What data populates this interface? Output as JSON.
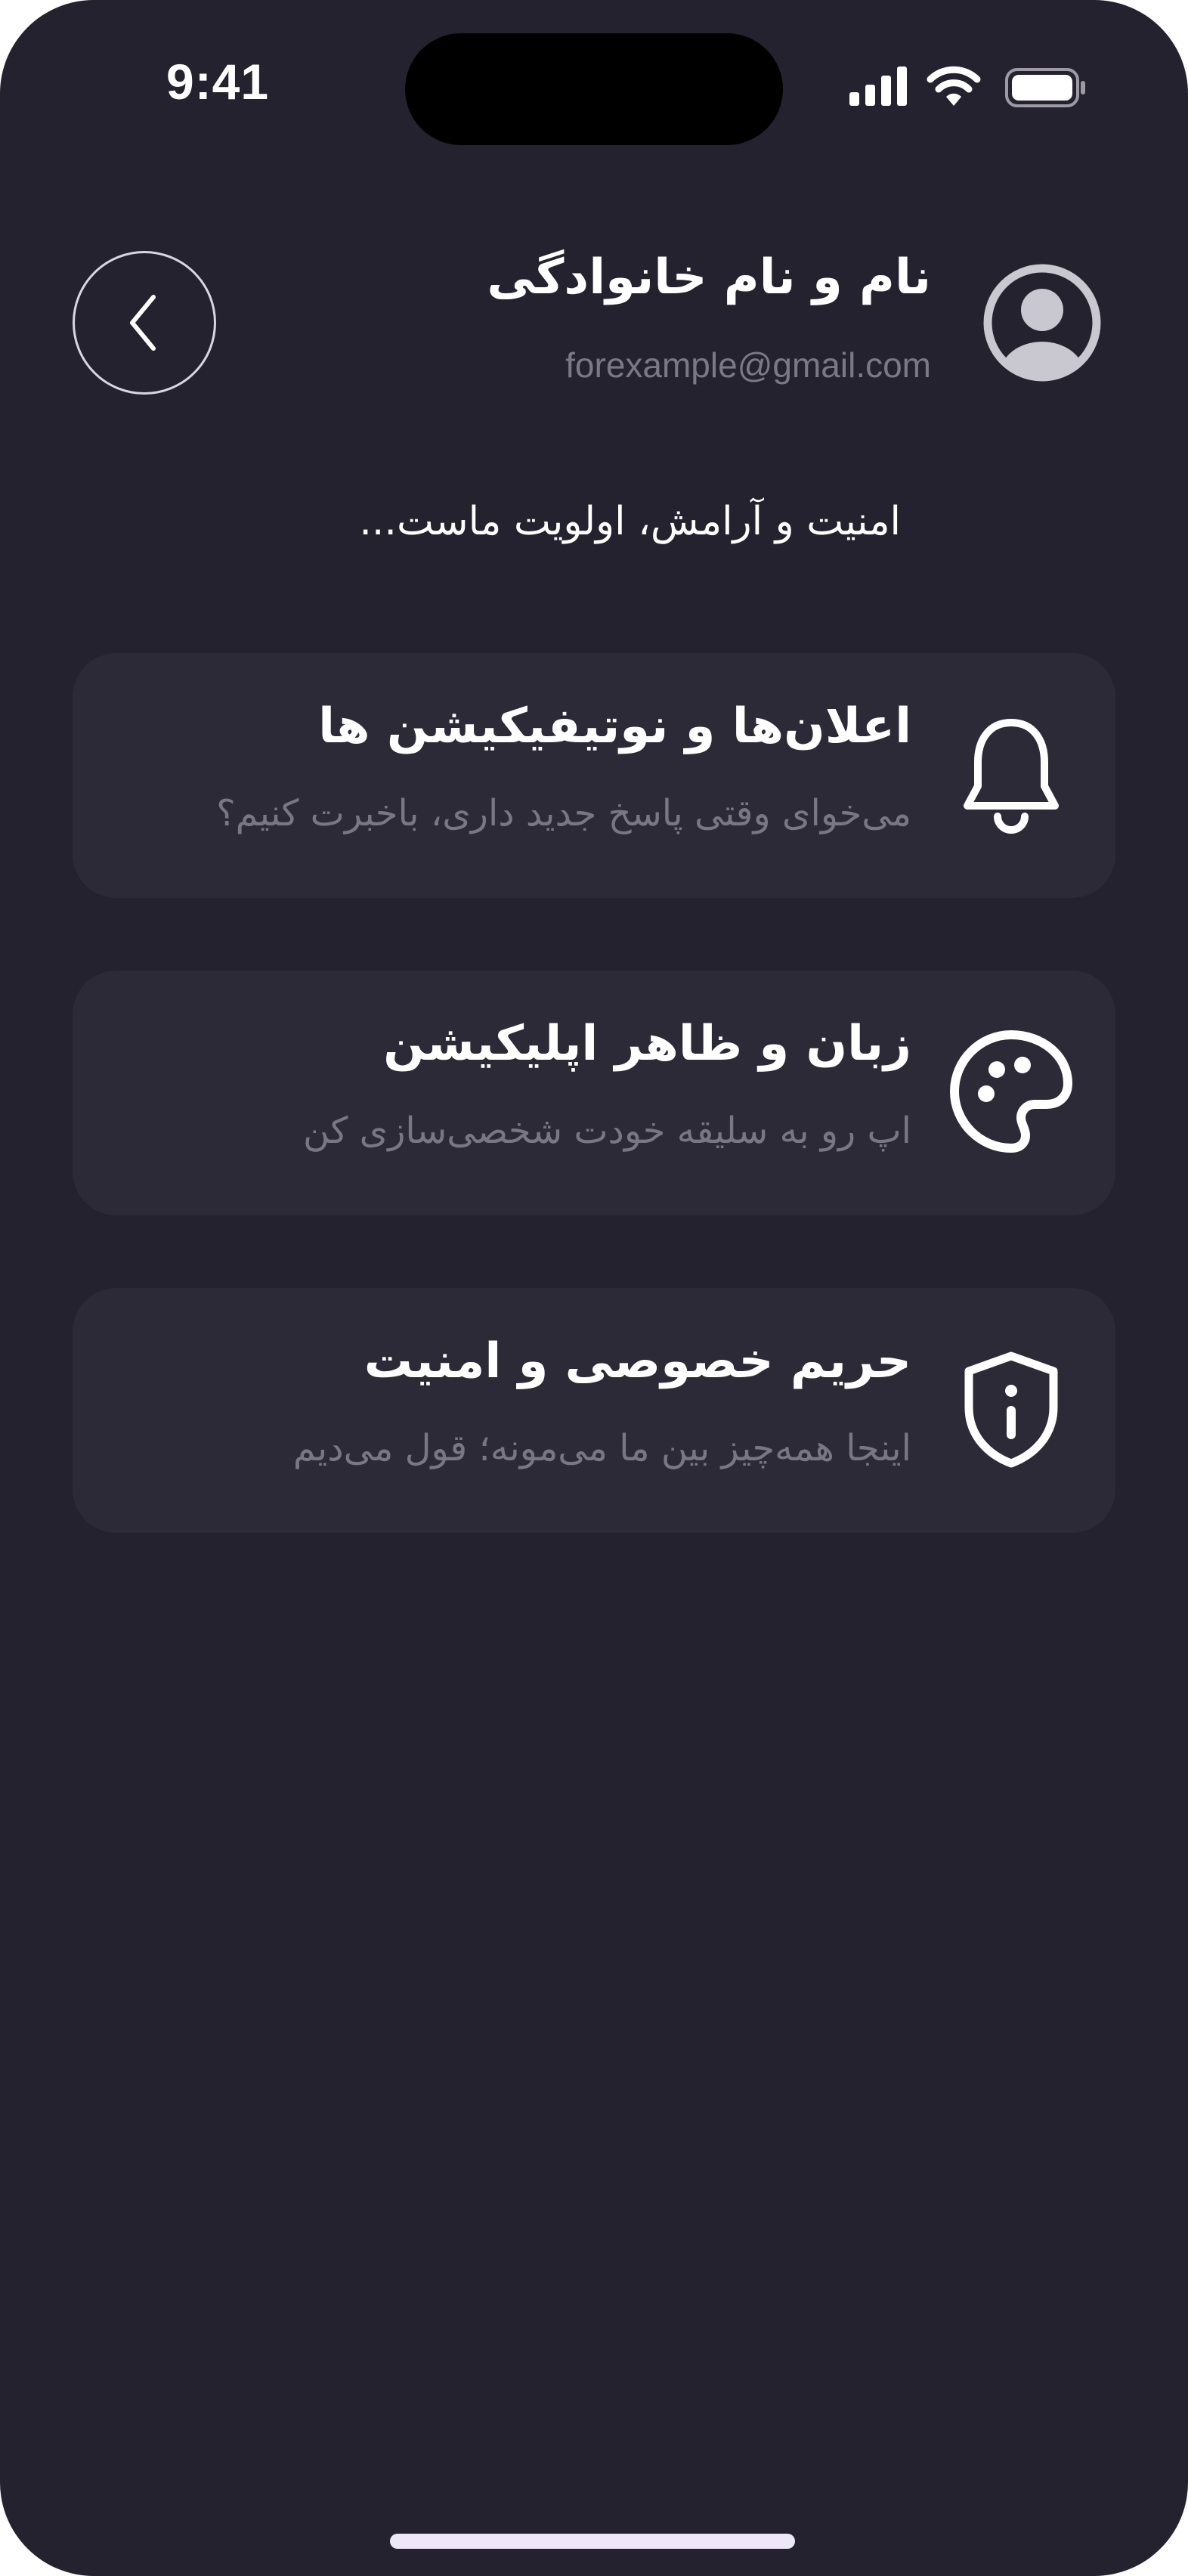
{
  "status_bar": {
    "time": "9:41"
  },
  "header": {
    "back_icon": "chevron-left-icon",
    "avatar_icon": "user-avatar-icon",
    "user_name": "نام و نام خانوادگی",
    "email": "forexample@gmail.com"
  },
  "tagline": "امنیت و آرامش، اولویت ماست...",
  "settings": [
    {
      "icon": "bell-icon",
      "title": "اعلان‌ها و نوتیفیکیشن ها",
      "subtitle": "می‌خوای وقتی پاسخ جدید داری، باخبرت کنیم؟"
    },
    {
      "icon": "palette-icon",
      "title": "زبان و ظاهر اپلیکیشن",
      "subtitle": "اپ رو به سلیقه خودت شخصی‌سازی کن"
    },
    {
      "icon": "shield-info-icon",
      "title": "حریم خصوصی و امنیت",
      "subtitle": "اینجا همه‌چیز بین ما می‌مونه؛ قول می‌دیم"
    }
  ],
  "colors": {
    "background": "#25222f",
    "card": "#2d2a37",
    "text_primary": "#ffffff",
    "text_secondary": "#7a7784"
  }
}
